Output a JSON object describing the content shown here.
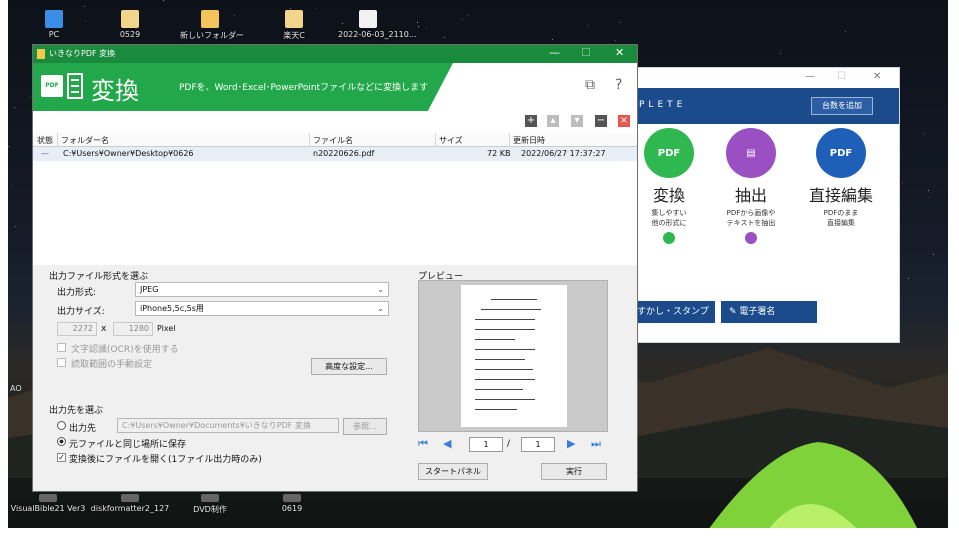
{
  "desktop": {
    "icons_top": [
      {
        "label": "PC",
        "color": "#3a8ee6"
      },
      {
        "label": "0529",
        "color": "#f2d48a"
      },
      {
        "label": "新しいフォルダー",
        "color": "#f2c45a"
      },
      {
        "label": "楽天C",
        "color": "#f2d48a"
      },
      {
        "label": "2022-06-03_2110...",
        "color": "#f2f2f2"
      }
    ],
    "icons_bottom": [
      {
        "label": "VisualBible21 Ver3"
      },
      {
        "label": "diskformatter2_127"
      },
      {
        "label": "DVD制作"
      },
      {
        "label": "0619"
      }
    ],
    "left_text": "AO"
  },
  "complete_window": {
    "brand": "PLETE",
    "add_button": "台数を追加",
    "features": [
      {
        "name": "変換",
        "desc": "集しやすい\n他の形式に",
        "color": "#2eb84f",
        "badge": "PDF"
      },
      {
        "name": "抽出",
        "desc": "PDFから画像や\nテキストを抽出",
        "color": "#9a4fc2",
        "badge": "▤"
      },
      {
        "name": "直接編集",
        "desc": "PDFのまま\n直接編集",
        "color": "#1e5fb8",
        "badge": "PDF"
      }
    ],
    "button_watermark": "すかし・スタンプ",
    "button_signature": "電子署名"
  },
  "main_window": {
    "title": "いきなりPDF  変換",
    "banner_title": "変換",
    "banner_subtitle": "PDFを、Word･Excel･PowerPointファイルなどに変換します",
    "pdf_badge": "PDF",
    "columns": [
      "状態",
      "フォルダー名",
      "ファイル名",
      "サイズ",
      "更新日時"
    ],
    "rows": [
      {
        "status": "—",
        "folder": "C:¥Users¥Owner¥Desktop¥0626",
        "file": "n20220626.pdf",
        "size": "72 KB",
        "modified": "2022/06/27 17:37:27"
      }
    ],
    "output_format_section": "出力ファイル形式を選ぶ",
    "format_label": "出力形式:",
    "format_value": "JPEG",
    "size_label": "出力サイズ:",
    "size_value": "iPhone5,5c,5s用",
    "width": "2272",
    "times": "x",
    "height": "1280",
    "unit": "Pixel",
    "ocr_label": "文字認識(OCR)を使用する",
    "manual_range_label": "読取範囲の手動設定",
    "advanced_button": "高度な設定...",
    "dest_section": "出力先を選ぶ",
    "dest_radio_label": "出力先",
    "dest_path": "C:¥Users¥Owner¥Documents¥いきなりPDF 変換",
    "browse_button": "参照...",
    "same_place_label": "元ファイルと同じ場所に保存",
    "open_after_label": "変換後にファイルを開く(1ファイル出力時のみ)",
    "preview_label": "プレビュー",
    "page_current": "1",
    "page_sep": "/",
    "page_total": "1",
    "start_panel_button": "スタートパネル",
    "run_button": "実行"
  }
}
